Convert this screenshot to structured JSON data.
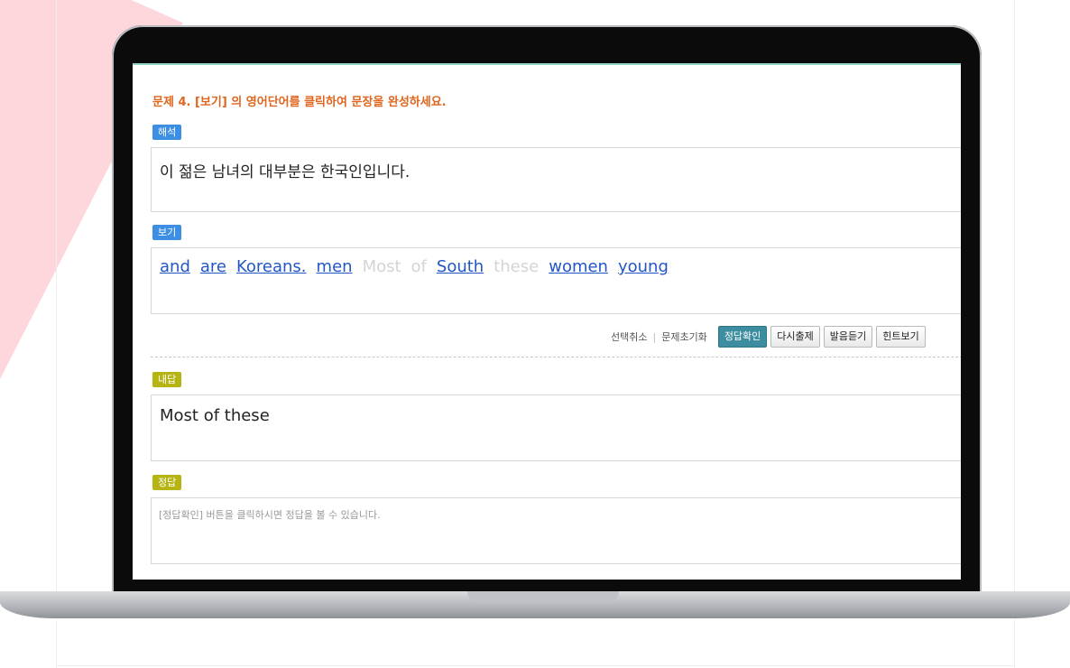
{
  "question": {
    "title": "문제 4. [보기] 의 영어단어를 클릭하여 문장을 완성하세요."
  },
  "translation": {
    "label": "해석",
    "text": "이 젊은 남녀의 대부분은 한국인입니다."
  },
  "choices": {
    "label": "보기",
    "words": [
      {
        "text": "and",
        "used": false
      },
      {
        "text": "are",
        "used": false
      },
      {
        "text": "Koreans.",
        "used": false
      },
      {
        "text": "men",
        "used": false
      },
      {
        "text": "Most",
        "used": true
      },
      {
        "text": "of",
        "used": true
      },
      {
        "text": "South",
        "used": false
      },
      {
        "text": "these",
        "used": true
      },
      {
        "text": "women",
        "used": false
      },
      {
        "text": "young",
        "used": false
      }
    ]
  },
  "controls": {
    "deselect": "선택취소",
    "reset": "문제초기화",
    "check_answer": "정답확인",
    "retry": "다시출제",
    "listen": "발음듣기",
    "hint": "힌트보기"
  },
  "my_answer": {
    "label": "내답",
    "text": "Most of these"
  },
  "correct_answer": {
    "label": "정답",
    "placeholder": "[정답확인] 버튼을 클릭하시면 정답을 볼 수 있습니다."
  },
  "colors": {
    "title": "#e0651e",
    "tag_blue": "#3c8fe3",
    "tag_olive": "#b5b413",
    "word_link": "#2256c7",
    "word_used": "#d4d4d4",
    "primary_button": "#3c8d9f"
  }
}
